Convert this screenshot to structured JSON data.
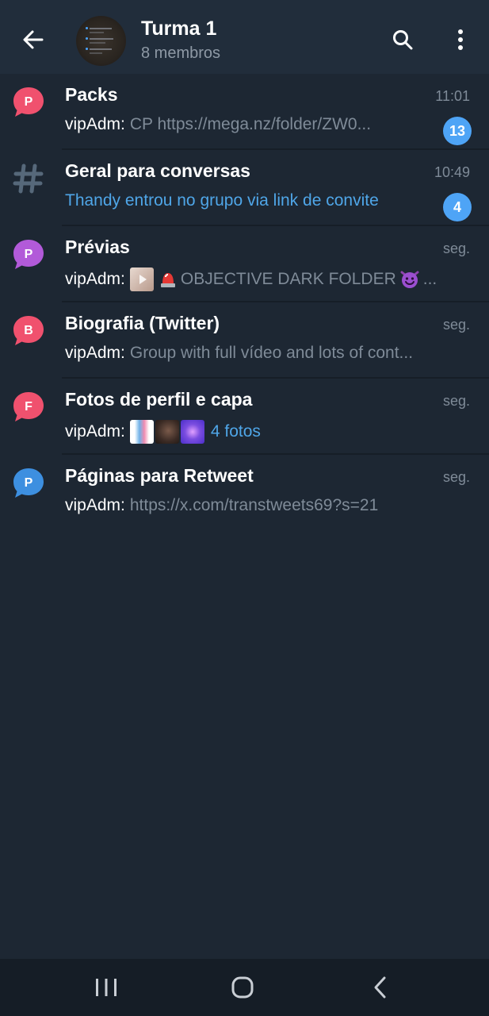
{
  "header": {
    "title": "Turma 1",
    "subtitle": "8 membros"
  },
  "topics": [
    {
      "icon_letter": "P",
      "icon_color": "#f0516e",
      "title": "Packs",
      "time": "11:01",
      "sender": "vipAdm:",
      "message": "CP https://mega.nz/folder/ZW0...",
      "badge": "13"
    },
    {
      "icon": "hashtag-icon",
      "title": "Geral para conversas",
      "time": "10:49",
      "message": "Thandy entrou no grupo via link de convite",
      "badge": "4"
    },
    {
      "icon_letter": "P",
      "icon_color": "#b25ad9",
      "title": "Prévias",
      "time": "seg.",
      "sender": "vipAdm:",
      "message": "OBJECTIVE DARK FOLDER",
      "trailing": "..."
    },
    {
      "icon_letter": "B",
      "icon_color": "#f0516e",
      "title": "Biografia (Twitter)",
      "time": "seg.",
      "sender": "vipAdm:",
      "message": "Group with full vídeo and lots of cont..."
    },
    {
      "icon_letter": "F",
      "icon_color": "#f0516e",
      "title": "Fotos de perfil e capa",
      "time": "seg.",
      "sender": "vipAdm:",
      "message": "4 fotos"
    },
    {
      "icon_letter": "P",
      "icon_color": "#3d8fe0",
      "title": "Páginas para Retweet",
      "time": "seg.",
      "sender": "vipAdm:",
      "message": "https://x.com/transtweets69?s=21"
    }
  ],
  "colors": {
    "background": "#1d2733",
    "header": "#212d3b",
    "accent": "#4ea4f6",
    "secondary_text": "#7f8b98"
  }
}
